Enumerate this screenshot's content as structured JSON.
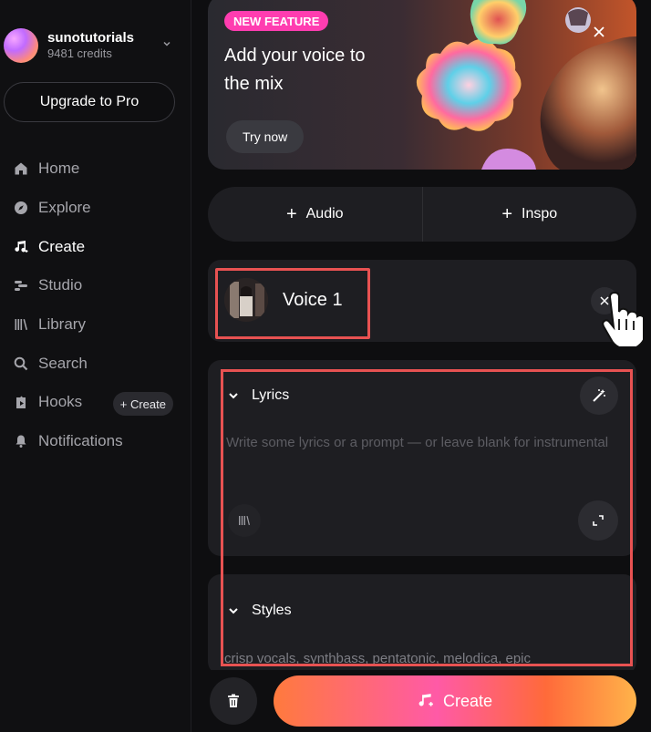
{
  "sidebar": {
    "username": "sunotutorials",
    "credits": "9481 credits",
    "upgrade_label": "Upgrade to Pro",
    "nav": [
      {
        "label": "Home",
        "icon": "home-icon",
        "active": false
      },
      {
        "label": "Explore",
        "icon": "compass-icon",
        "active": false
      },
      {
        "label": "Create",
        "icon": "music-note-icon",
        "active": true
      },
      {
        "label": "Studio",
        "icon": "studio-icon",
        "active": false
      },
      {
        "label": "Library",
        "icon": "library-icon",
        "active": false
      },
      {
        "label": "Search",
        "icon": "search-icon",
        "active": false
      },
      {
        "label": "Hooks",
        "icon": "hooks-icon",
        "active": false
      },
      {
        "label": "Notifications",
        "icon": "bell-icon",
        "active": false
      }
    ],
    "hooks_create_label": "+ Create"
  },
  "banner": {
    "badge": "NEW FEATURE",
    "title": "Add your voice to the mix",
    "try_label": "Try now"
  },
  "add_row": {
    "audio_label": "Audio",
    "inspo_label": "Inspo"
  },
  "voice": {
    "label": "Voice 1"
  },
  "lyrics": {
    "heading": "Lyrics",
    "placeholder": "Write some lyrics or a prompt — or leave blank for instrumental"
  },
  "styles": {
    "heading": "Styles",
    "value": "crisp vocals, synthbass, pentatonic, melodica, epic"
  },
  "bottom": {
    "create_label": "Create"
  },
  "colors": {
    "background": "#0e0e10",
    "card": "#1e1e22",
    "badge": "#ff3db0",
    "highlight": "#e85252",
    "create_gradient_start": "#ff7a3d",
    "create_gradient_end": "#ffb34a"
  }
}
